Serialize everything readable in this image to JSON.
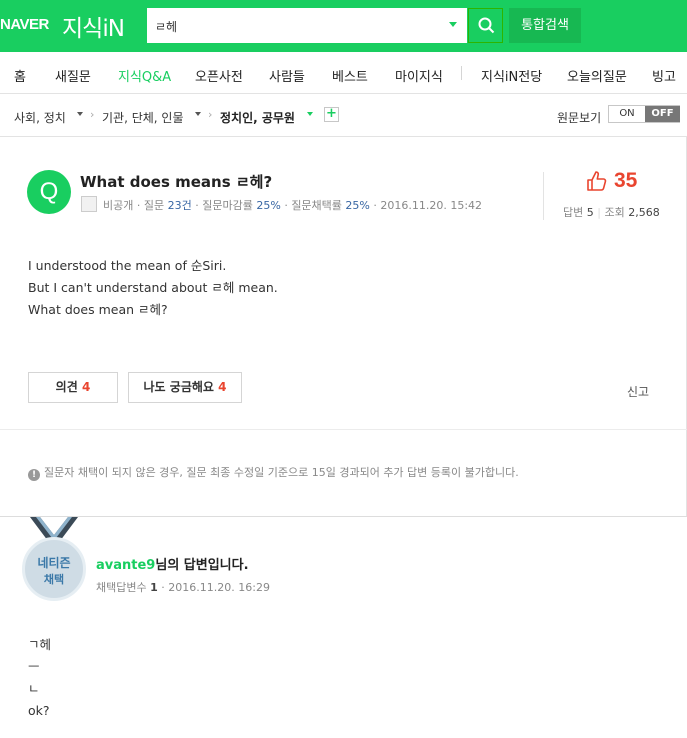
{
  "header": {
    "logo_naver": "NAVER",
    "logo_service": "지식iN",
    "search_value": "ㄹ헤",
    "total_search_label": "통합검색"
  },
  "nav": {
    "items": [
      "홈",
      "새질문",
      "지식Q&A",
      "오픈사전",
      "사람들",
      "베스트",
      "마이지식",
      "지식iN전당",
      "오늘의질문",
      "빙고"
    ],
    "active": "지식Q&A"
  },
  "breadcrumb": {
    "level1": "사회, 정치",
    "level2": "기관, 단체, 인물",
    "level3": "정치인, 공무원",
    "add_label": "+",
    "original_view_label": "원문보기",
    "toggle_on": "ON",
    "toggle_off": "OFF"
  },
  "question": {
    "badge": "Q",
    "title": "What does means ㄹ헤?",
    "author": "비공개",
    "question_count_label": "질문",
    "question_count": "23건",
    "close_rate_label": "질문마감률",
    "close_rate": "25%",
    "adopt_rate_label": "질문채택률",
    "adopt_rate": "25%",
    "date": "2016.11.20. 15:42",
    "likes": "35",
    "answers_label": "답변",
    "answers": "5",
    "views_label": "조회",
    "views": "2,568",
    "body": [
      "I understood the mean of 순Siri.",
      "But I can't understand about ㄹ헤 mean.",
      "What does mean ㄹ헤?"
    ],
    "opinion_label": "의견",
    "opinion_count": "4",
    "curious_label": "나도 궁금해요",
    "curious_count": "4",
    "report_label": "신고",
    "notice": "질문자 채택이 되지 않은 경우, 질문 최종 수정일 기준으로 15일 경과되어 추가 답변 등록이 불가합니다."
  },
  "answer": {
    "medal_line1": "네티즌",
    "medal_line2": "채택",
    "user": "avante9",
    "title_suffix": "님의 답변입니다.",
    "adopted_label": "채택답변수",
    "adopted_count": "1",
    "date": "2016.11.20. 16:29",
    "body": [
      "ㄱ헤",
      "ㅡ",
      "ㄴ",
      "ok?"
    ]
  },
  "colors": {
    "brand": "#19ce60",
    "accent_red": "#e9452f",
    "link_blue": "#3866a3"
  }
}
